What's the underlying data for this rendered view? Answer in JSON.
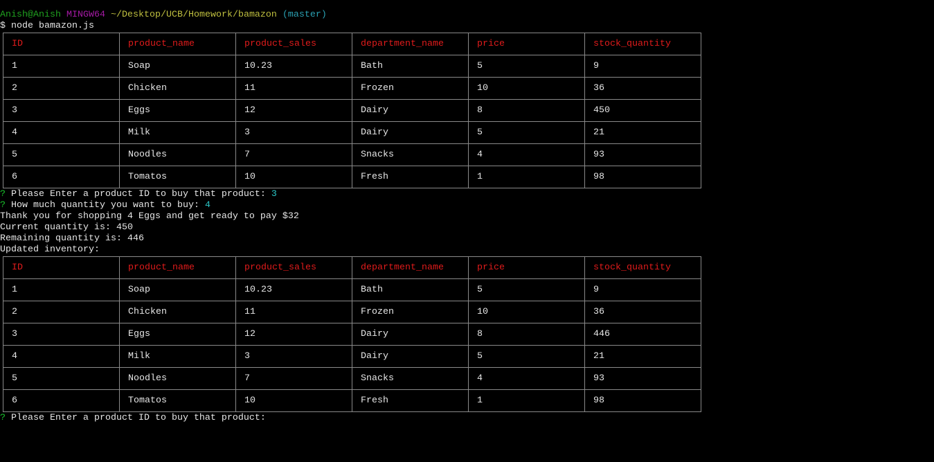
{
  "prompt": {
    "user": "Anish@Anish",
    "system": "MINGW64",
    "path": "~/Desktop/UCB/Homework/bamazon",
    "branch": "(master)"
  },
  "command": "$ node bamazon.js",
  "table_headers": [
    "ID",
    "product_name",
    "product_sales",
    "department_name",
    "price",
    "stock_quantity"
  ],
  "table_before": [
    [
      "1",
      "Soap",
      "10.23",
      "Bath",
      "5",
      "9"
    ],
    [
      "2",
      "Chicken",
      "11",
      "Frozen",
      "10",
      "36"
    ],
    [
      "3",
      "Eggs",
      "12",
      "Dairy",
      "8",
      "450"
    ],
    [
      "4",
      "Milk",
      "3",
      "Dairy",
      "5",
      "21"
    ],
    [
      "5",
      "Noodles",
      "7",
      "Snacks",
      "4",
      "93"
    ],
    [
      "6",
      "Tomatos",
      "10",
      "Fresh",
      "1",
      "98"
    ]
  ],
  "table_after": [
    [
      "1",
      "Soap",
      "10.23",
      "Bath",
      "5",
      "9"
    ],
    [
      "2",
      "Chicken",
      "11",
      "Frozen",
      "10",
      "36"
    ],
    [
      "3",
      "Eggs",
      "12",
      "Dairy",
      "8",
      "446"
    ],
    [
      "4",
      "Milk",
      "3",
      "Dairy",
      "5",
      "21"
    ],
    [
      "5",
      "Noodles",
      "7",
      "Snacks",
      "4",
      "93"
    ],
    [
      "6",
      "Tomatos",
      "10",
      "Fresh",
      "1",
      "98"
    ]
  ],
  "q_mark": "?",
  "q1": {
    "text": " Please Enter a product ID to buy that product: ",
    "answer": "3"
  },
  "q2": {
    "text": " How much quantity you want to buy: ",
    "answer": "4"
  },
  "messages": [
    "Thank you for shopping 4 Eggs and get ready to pay $32",
    "Current quantity is: 450",
    "Remaining quantity is: 446",
    "Updated inventory:"
  ],
  "q3": {
    "text": " Please Enter a product ID to buy that product:"
  }
}
